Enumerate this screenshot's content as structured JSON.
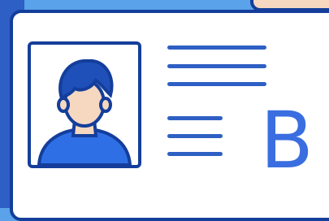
{
  "card": {
    "grade_letter": "B"
  },
  "colors": {
    "card_border": "#143e9b",
    "line_color": "#2e5fc4",
    "background_top": "#5aa2e9",
    "background_left": "#2e5fc4",
    "skin": "#f6d7c0",
    "hair": "#1f4fb8",
    "shirt": "#2f6fe6",
    "grade_text": "#3a6ee0"
  },
  "icons": {
    "portrait": "person-icon"
  }
}
